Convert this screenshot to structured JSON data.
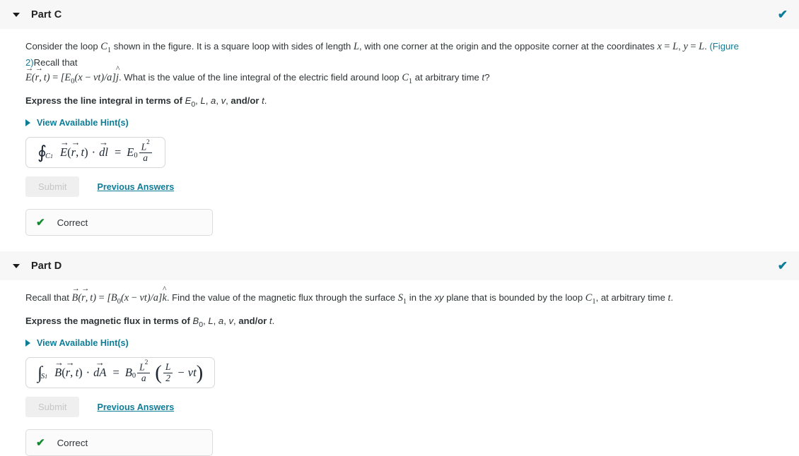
{
  "parts": [
    {
      "id": "part-c",
      "title": "Part C",
      "collapse_icon": "caret-down-icon",
      "status_icon": "check-icon",
      "status_icon_color": "#0c7c99",
      "prompt_text_1": "Consider the loop ",
      "prompt_math_c1": "C",
      "prompt_math_c1_sub": "1",
      "prompt_text_2": " shown in the figure. It is a square loop with sides of length ",
      "prompt_math_L": "L",
      "prompt_text_3": ", with one corner at the origin and the opposite corner at the coordinates ",
      "prompt_math_xL": "x = L",
      "prompt_text_4": ", ",
      "prompt_math_yL": "y = L",
      "prompt_text_5": ". ",
      "figure_link": "(Figure 2)",
      "prompt_text_6": "Recall that ",
      "prompt_field_eq": "E(r, t) = [E0(x − vt)/a] j",
      "prompt_text_7": ". What is the value of the line integral of the electric field around loop ",
      "prompt_text_8": " at arbitrary time ",
      "prompt_math_t": "t",
      "prompt_text_9": "?",
      "express_label_a": "Express the line integral in terms of ",
      "express_vars": "E0, L, a, v, and/or t.",
      "hints_label": "View Available Hint(s)",
      "hints_icon": "caret-right-icon",
      "answer_lhs": "∮C1 E(r, t) · dl",
      "answer_rhs": "E0 L²/a",
      "submit_label": "Submit",
      "submit_disabled": true,
      "previous_answers_label": "Previous Answers",
      "feedback_text": "Correct",
      "feedback_icon": "check-icon",
      "feedback_icon_color": "#138a2e"
    },
    {
      "id": "part-d",
      "title": "Part D",
      "collapse_icon": "caret-down-icon",
      "status_icon": "check-icon",
      "status_icon_color": "#0c7c99",
      "prompt_text_1": "Recall that ",
      "prompt_field_eq": "B(r, t) = [B0(x − vt)/a] k",
      "prompt_text_2": ". Find the value of the magnetic flux through the surface ",
      "prompt_math_S1": "S",
      "prompt_math_S1_sub": "1",
      "prompt_text_3": " in the ",
      "prompt_math_xy": "xy",
      "prompt_text_4": " plane that is bounded by the loop ",
      "prompt_math_C1": "C",
      "prompt_math_C1_sub": "1",
      "prompt_text_5": ", at arbitrary time ",
      "prompt_math_t": "t",
      "prompt_text_6": ".",
      "express_label_a": "Express the magnetic flux in terms of ",
      "express_vars": "B0, L, a, v, and/or t.",
      "hints_label": "View Available Hint(s)",
      "hints_icon": "caret-right-icon",
      "answer_lhs": "∫S1 B(r, t) · dA",
      "answer_rhs": "B0 L²/a (L/2 − vt)",
      "submit_label": "Submit",
      "submit_disabled": true,
      "previous_answers_label": "Previous Answers",
      "feedback_text": "Correct",
      "feedback_icon": "check-icon",
      "feedback_icon_color": "#138a2e"
    }
  ],
  "symbols": {
    "check": "✔",
    "oint": "∮",
    "int": "∫",
    "dot": "·",
    "minus": "−",
    "equals": "=",
    "E": "E",
    "B": "B",
    "r": "r",
    "t": "t",
    "L": "L",
    "a": "a",
    "v": "v",
    "x": "x",
    "y": "y",
    "j": "j",
    "k": "k",
    "two": "2",
    "zero": "0",
    "one": "1",
    "C": "C",
    "S": "S",
    "dl": "dl",
    "dA": "dA"
  }
}
